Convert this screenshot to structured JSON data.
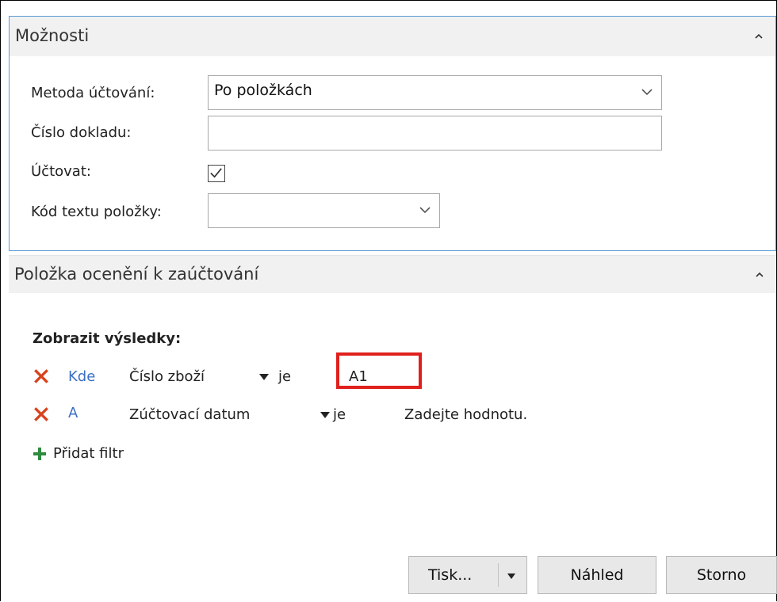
{
  "options_section": {
    "title": "Možnosti",
    "fields": {
      "posting_method": {
        "label": "Metoda účtování:",
        "value": "Po položkách"
      },
      "document_no": {
        "label": "Číslo dokladu:",
        "value": ""
      },
      "post": {
        "label": "Účtovat:",
        "checked": true
      },
      "item_text_code": {
        "label": "Kód textu položky:",
        "value": ""
      }
    }
  },
  "entries_section": {
    "title": "Položka ocenění k zaúčtování",
    "show_results_label": "Zobrazit výsledky:",
    "filters": [
      {
        "keyword": "Kde",
        "field": "Číslo zboží",
        "operator": "je",
        "value": "A1"
      },
      {
        "keyword": "A",
        "field": "Zúčtovací datum",
        "operator": "je",
        "value": "Zadejte hodnotu."
      }
    ],
    "add_filter_label": "Přidat filtr"
  },
  "buttons": {
    "print_label": "Tisk...",
    "preview_label": "Náhled",
    "cancel_label": "Storno"
  },
  "colors": {
    "accent_border": "#5a9bd5",
    "link_blue": "#3a6fc4",
    "remove_red": "#d9421c",
    "add_green": "#2e8b3e",
    "highlight_red": "#e0201c"
  }
}
